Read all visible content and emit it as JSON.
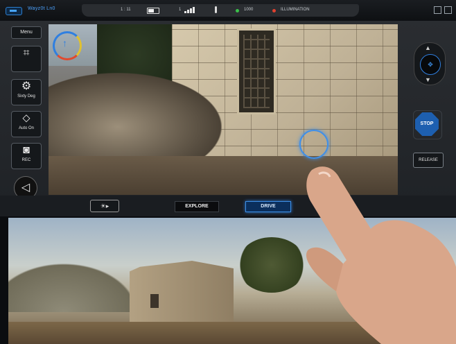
{
  "statusbar": {
    "app_title": "Wayz0t Ln0",
    "center_code": "1 : 11",
    "signal_label": "1",
    "stat_1": "1000",
    "stat_2": "ILLUMINATION"
  },
  "left_tools": {
    "menu_label": "Menu",
    "tool_2_label": "",
    "tool_3_label": "Sixty Deg",
    "tool_4_label": "Auto On",
    "tool_5_label": "REC"
  },
  "right_controls": {
    "stop_label": "STOP",
    "release_label": "RELEASE"
  },
  "modebar": {
    "explore_label": "EXPLORE",
    "drive_label": "DRIVE"
  },
  "icons": {
    "compass": "compass-icon",
    "speaker": "speaker-icon",
    "joystick": "joystick-icon"
  },
  "colors": {
    "accent": "#2f7fe0",
    "stop": "#1d5fb0",
    "frame": "#24272b"
  }
}
